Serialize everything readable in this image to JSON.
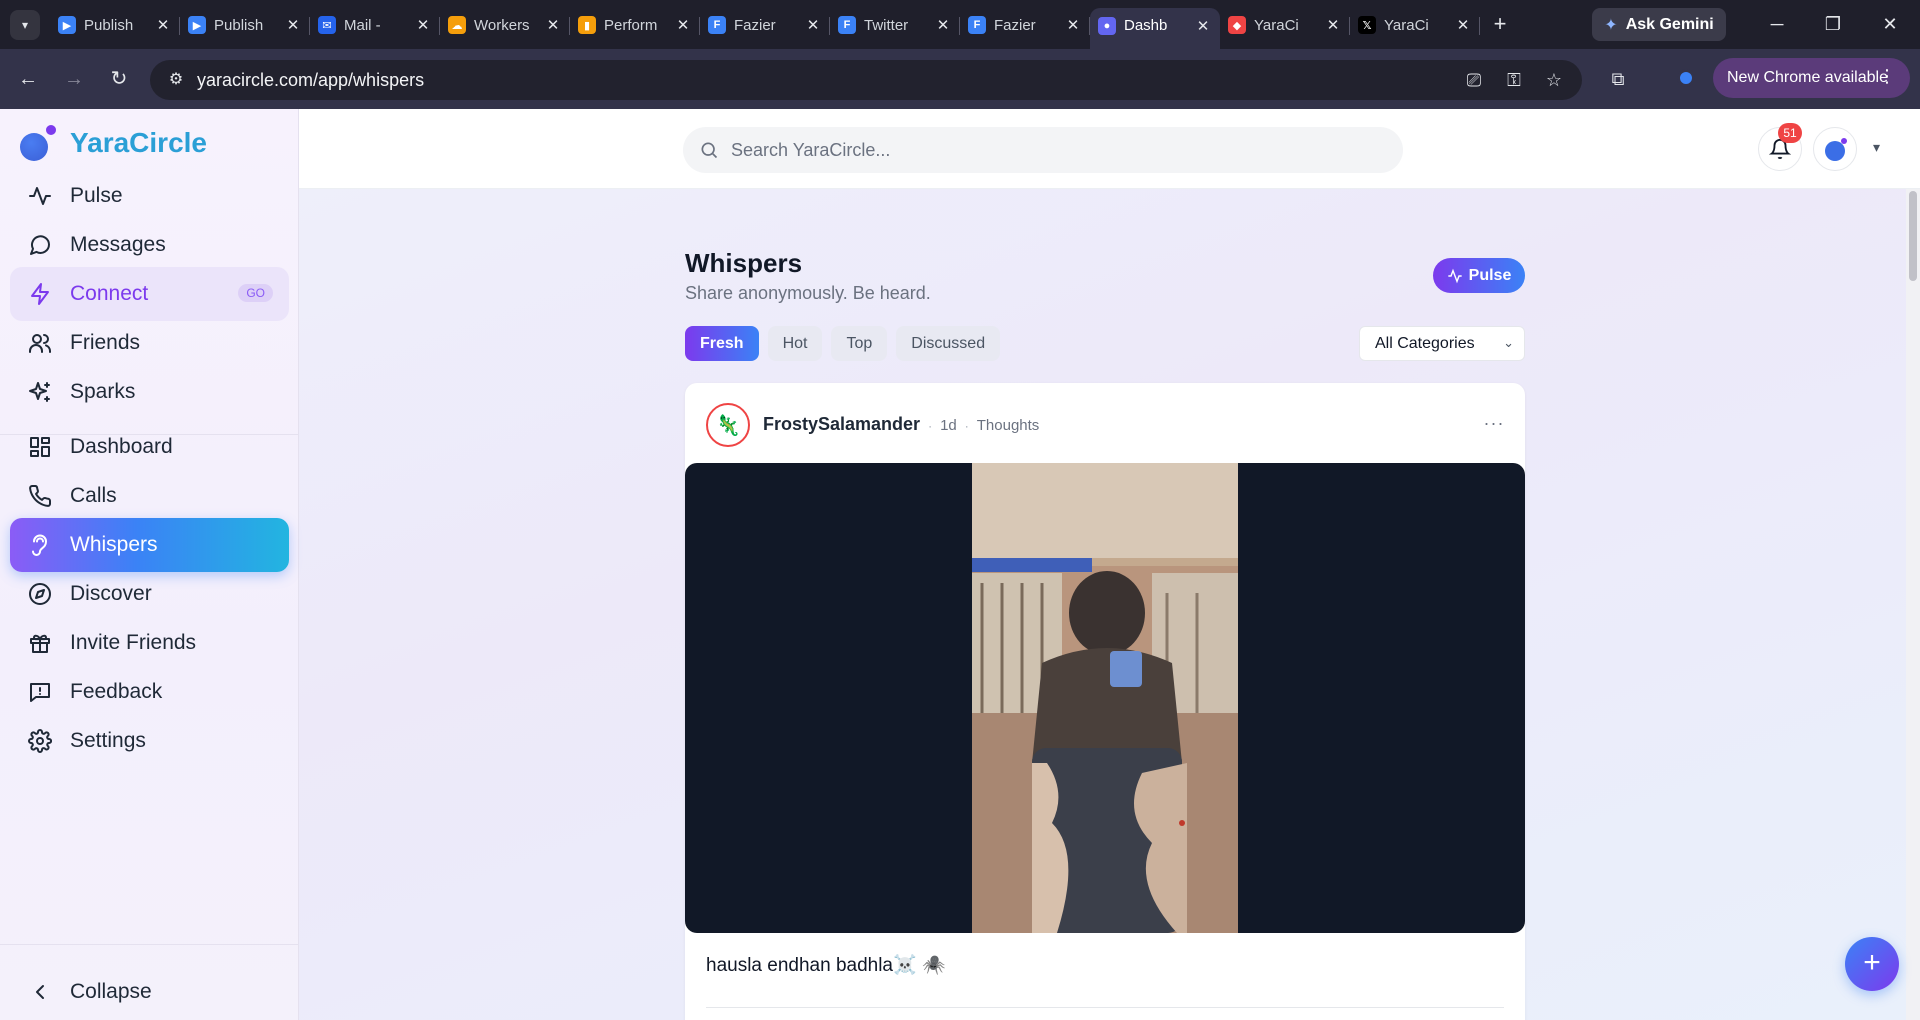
{
  "browser": {
    "tabs": [
      {
        "label": "Publish",
        "color": "#3b82f6",
        "glyph": "▶"
      },
      {
        "label": "Publish",
        "color": "#3b82f6",
        "glyph": "▶"
      },
      {
        "label": "Mail -",
        "color": "#2563eb",
        "glyph": "✉"
      },
      {
        "label": "Workers",
        "color": "#f59e0b",
        "glyph": "☁"
      },
      {
        "label": "Perform",
        "color": "#f59e0b",
        "glyph": "▮"
      },
      {
        "label": "Fazier",
        "color": "#3b82f6",
        "glyph": "F"
      },
      {
        "label": "Twitter",
        "color": "#3b82f6",
        "glyph": "F"
      },
      {
        "label": "Fazier",
        "color": "#3b82f6",
        "glyph": "F"
      },
      {
        "label": "Dashb",
        "color": "#6366f1",
        "glyph": "●"
      },
      {
        "label": "YaraCi",
        "color": "#ef4444",
        "glyph": "◆"
      },
      {
        "label": "YaraCi",
        "color": "#000000",
        "glyph": "𝕏"
      }
    ],
    "active_tab_index": 8,
    "ask_gemini": "Ask Gemini",
    "url": "yaracircle.com/app/whispers",
    "update_label": "New Chrome available"
  },
  "app": {
    "name": "YaraCircle",
    "search_placeholder": "Search YaraCircle...",
    "notification_count": "51"
  },
  "sidebar": {
    "primary": [
      {
        "label": "Pulse",
        "icon": "pulse-icon"
      },
      {
        "label": "Messages",
        "icon": "message-icon"
      },
      {
        "label": "Connect",
        "icon": "bolt-icon",
        "badge": "GO"
      },
      {
        "label": "Friends",
        "icon": "friends-icon"
      },
      {
        "label": "Sparks",
        "icon": "sparkles-icon"
      }
    ],
    "secondary": [
      {
        "label": "Dashboard",
        "icon": "dashboard-icon"
      },
      {
        "label": "Calls",
        "icon": "phone-icon"
      },
      {
        "label": "Whispers",
        "icon": "ear-icon"
      },
      {
        "label": "Discover",
        "icon": "compass-icon"
      },
      {
        "label": "Invite Friends",
        "icon": "gift-icon"
      },
      {
        "label": "Feedback",
        "icon": "feedback-icon"
      },
      {
        "label": "Settings",
        "icon": "gear-icon"
      }
    ],
    "collapse_label": "Collapse"
  },
  "page": {
    "title": "Whispers",
    "subtitle": "Share anonymously. Be heard.",
    "pulse_button": "Pulse",
    "filter_tabs": [
      "Fresh",
      "Hot",
      "Top",
      "Discussed"
    ],
    "category_select": "All Categories"
  },
  "post": {
    "username": "FrostySalamander",
    "age": "1d",
    "category": "Thoughts",
    "text": "hausla endhan badhla☠️ 🕷️",
    "avatar_icon": "salamander-icon"
  },
  "colors": {
    "accent_purple": "#7c3aed",
    "accent_blue": "#3b82f6",
    "brand": "#2b9fd6",
    "badge_red": "#ef4444"
  }
}
